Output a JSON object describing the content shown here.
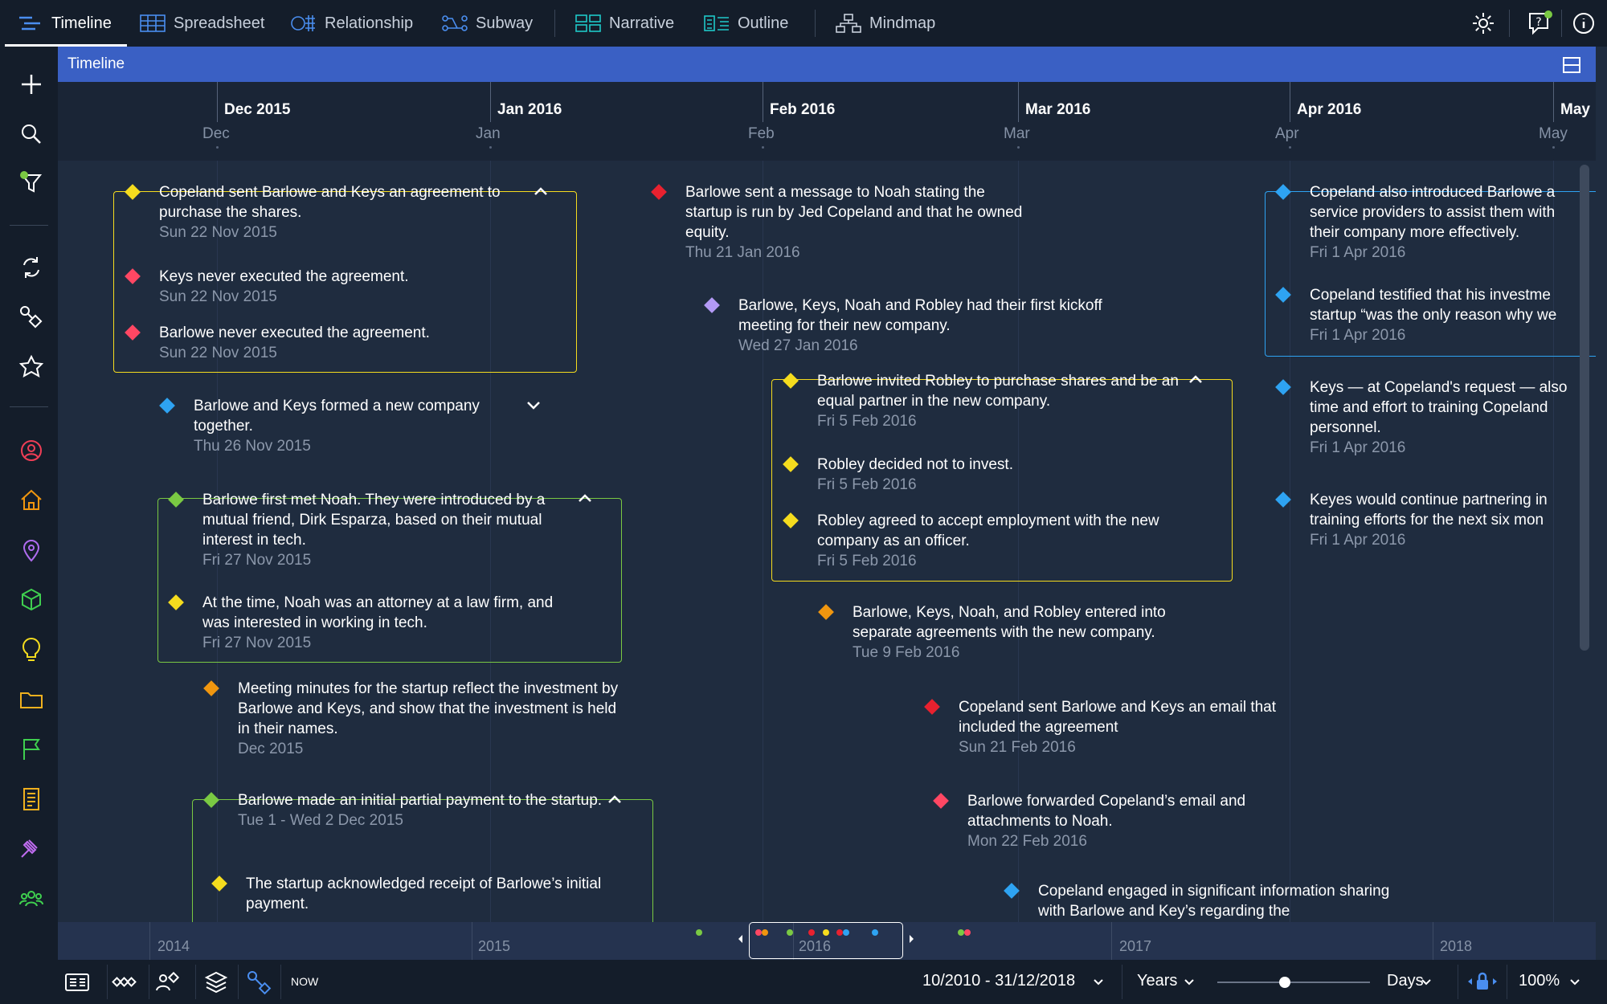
{
  "tabs": [
    {
      "label": "Timeline",
      "icon": "timeline-icon",
      "active": true
    },
    {
      "label": "Spreadsheet",
      "icon": "spreadsheet-icon"
    },
    {
      "label": "Relationship",
      "icon": "relationship-icon"
    },
    {
      "label": "Subway",
      "icon": "subway-icon"
    },
    {
      "label": "Narrative",
      "icon": "narrative-icon"
    },
    {
      "label": "Outline",
      "icon": "outline-icon"
    },
    {
      "label": "Mindmap",
      "icon": "mindmap-icon"
    }
  ],
  "panel": {
    "title": "Timeline"
  },
  "axis": {
    "months": [
      {
        "label": "Dec 2015",
        "short": "Dec"
      },
      {
        "label": "Jan 2016",
        "short": "Jan"
      },
      {
        "label": "Feb 2016",
        "short": "Feb"
      },
      {
        "label": "Mar 2016",
        "short": "Mar"
      },
      {
        "label": "Apr 2016",
        "short": "Apr"
      },
      {
        "label": "May",
        "short": "May"
      }
    ]
  },
  "events": [
    {
      "title": "Copeland sent Barlowe and Keys an agreement to purchase the shares.",
      "date": "Sun 22 Nov 2015",
      "color": "#f5dc1e"
    },
    {
      "title": "Keys never executed the agreement.",
      "date": "Sun 22 Nov 2015",
      "color": "#ff4763"
    },
    {
      "title": "Barlowe never executed the agreement.",
      "date": "Sun 22 Nov 2015",
      "color": "#ff4763"
    },
    {
      "title": "Barlowe and Keys formed a new company together.",
      "date": "Thu 26 Nov 2015",
      "color": "#2ea3f2"
    },
    {
      "title": "Barlowe first met Noah. They were introduced by a mutual friend, Dirk Esparza, based on their mutual interest in tech.",
      "date": "Fri 27 Nov 2015",
      "color": "#7ac943"
    },
    {
      "title": "At the time, Noah was an attorney at a law firm, and was interested in working in tech.",
      "date": "Fri 27 Nov 2015",
      "color": "#f5dc1e"
    },
    {
      "title": "Meeting minutes for the startup reflect the investment by Barlowe and Keys, and show that the investment is held in their names.",
      "date": "Dec 2015",
      "color": "#f0960f"
    },
    {
      "title": "Barlowe made an initial partial payment to the startup.",
      "date": "Tue 1 - Wed 2 Dec 2015",
      "color": "#7ac943"
    },
    {
      "title": "The startup acknowledged receipt of Barlowe’s initial payment.",
      "date": "",
      "color": "#f5dc1e"
    },
    {
      "title": "Barlowe sent a message to Noah stating the startup is run by Jed Copeland and that he owned equity.",
      "date": "Thu 21 Jan 2016",
      "color": "#e8212f"
    },
    {
      "title": "Barlowe, Keys, Noah and Robley had their first kickoff meeting for their new company.",
      "date": "Wed 27 Jan 2016",
      "color": "#b39af5"
    },
    {
      "title": "Barlowe invited Robley to purchase shares and be an equal partner in the new company.",
      "date": "Fri 5 Feb 2016",
      "color": "#f5dc1e"
    },
    {
      "title": "Robley decided not to invest.",
      "date": "Fri 5 Feb 2016",
      "color": "#f5dc1e"
    },
    {
      "title": "Robley agreed to accept employment with the new company as an officer.",
      "date": "Fri 5 Feb 2016",
      "color": "#f5dc1e"
    },
    {
      "title": "Barlowe, Keys, Noah, and Robley entered into separate agreements with the new company.",
      "date": "Tue 9 Feb 2016",
      "color": "#f0960f"
    },
    {
      "title": "Copeland sent Barlowe and Keys an email that included the agreement",
      "date": "Sun 21 Feb 2016",
      "color": "#e8212f"
    },
    {
      "title": "Barlowe forwarded Copeland’s email and attachments to Noah.",
      "date": "Mon 22 Feb 2016",
      "color": "#ff4763"
    },
    {
      "title": "Copeland engaged in significant information sharing with Barlowe and Key’s regarding the",
      "date": "",
      "color": "#2ea3f2"
    },
    {
      "title": "Copeland also introduced Barlowe a service providers to assist them with their company more effectively.",
      "date": "Fri 1 Apr 2016",
      "color": "#2ea3f2"
    },
    {
      "title": "Copeland testified that his investme startup “was the only reason why we",
      "date": "Fri 1 Apr 2016",
      "color": "#2ea3f2"
    },
    {
      "title": "Keys — at Copeland's request — also time and effort to training Copeland personnel.",
      "date": "Fri 1 Apr 2016",
      "color": "#2ea3f2"
    },
    {
      "title": "Keyes would continue partnering in training efforts for the next six mon",
      "date": "Fri 1 Apr 2016",
      "color": "#2ea3f2"
    }
  ],
  "overview": {
    "years": [
      "2014",
      "2015",
      "2016",
      "2017",
      "2018"
    ]
  },
  "bottombar": {
    "now_label": "NOW",
    "date_range": "10/2010 - 31/12/2018",
    "scale_unit": "Years",
    "detail_unit": "Days",
    "zoom": "100%"
  },
  "colors": {
    "topbar": "#141d2a",
    "panel_header": "#3a60c4",
    "canvas": "#1f2c3f",
    "group_yellow": "#f5dc1e",
    "group_green": "#7ac943",
    "group_blue": "#2ea3f2"
  }
}
